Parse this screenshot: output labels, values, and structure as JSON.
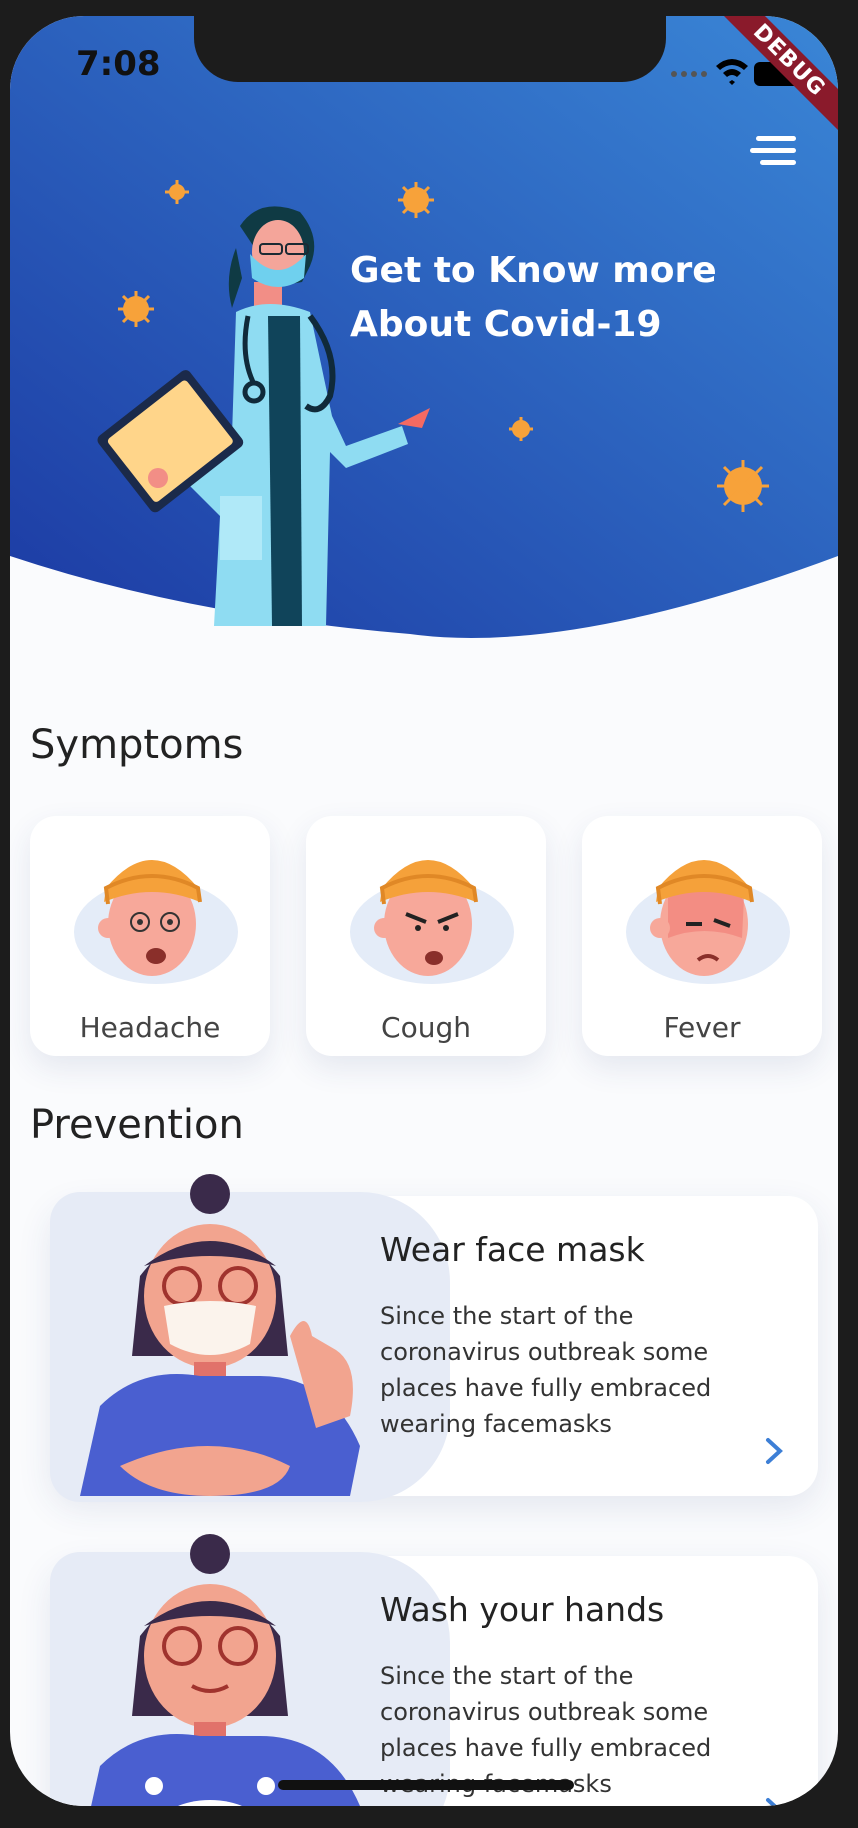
{
  "status_bar": {
    "time": "7:08",
    "debug_label": "DEBUG"
  },
  "hero": {
    "title_line1": "Get to Know more",
    "title_line2": "About Covid-19"
  },
  "symptoms": {
    "title": "Symptoms",
    "items": [
      {
        "label": "Headache"
      },
      {
        "label": "Cough"
      },
      {
        "label": "Fever"
      }
    ]
  },
  "prevention": {
    "title": "Prevention",
    "items": [
      {
        "title": "Wear face mask",
        "text": "Since the start of the coronavirus outbreak some places have fully embraced wearing facemasks"
      },
      {
        "title": "Wash your hands",
        "text": "Since the start of the coronavirus outbreak some places have fully embraced wearing facemasks"
      }
    ]
  },
  "colors": {
    "hero_start": "#3385d8",
    "hero_end": "#1e3ea6",
    "accent": "#3d7fd6",
    "text": "#222222"
  },
  "icons": [
    "menu-icon",
    "chevron-right-icon",
    "wifi-icon",
    "battery-icon",
    "signal-icon"
  ]
}
